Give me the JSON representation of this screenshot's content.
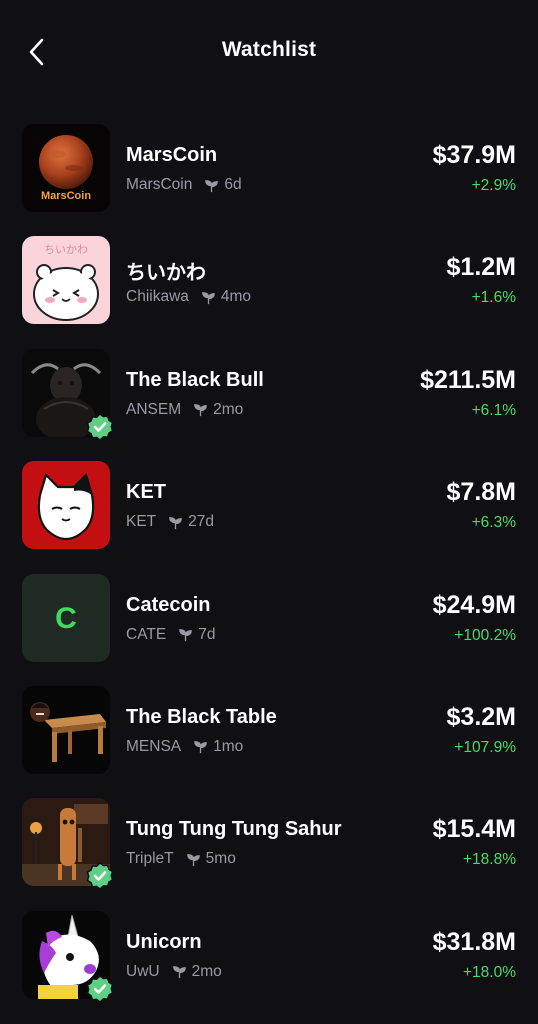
{
  "header": {
    "title": "Watchlist",
    "back_icon": "chevron-left-icon"
  },
  "colors": {
    "background": "#0f0f14",
    "positive": "#4cd964",
    "muted": "#9a9aa4",
    "verified": "#5fcf86"
  },
  "tokens": [
    {
      "name": "MarsCoin",
      "ticker": "MarsCoin",
      "age": "6d",
      "market_cap": "$37.9M",
      "change": "+2.9%",
      "verified": false,
      "thumb_label": "MarsCoin"
    },
    {
      "name": "ちいかわ",
      "ticker": "Chiikawa",
      "age": "4mo",
      "market_cap": "$1.2M",
      "change": "+1.6%",
      "verified": false,
      "thumb_label": "ちいかわ"
    },
    {
      "name": "The Black Bull",
      "ticker": "ANSEM",
      "age": "2mo",
      "market_cap": "$211.5M",
      "change": "+6.1%",
      "verified": true
    },
    {
      "name": "KET",
      "ticker": "KET",
      "age": "27d",
      "market_cap": "$7.8M",
      "change": "+6.3%",
      "verified": false
    },
    {
      "name": "Catecoin",
      "ticker": "CATE",
      "age": "7d",
      "market_cap": "$24.9M",
      "change": "+100.2%",
      "verified": false,
      "thumb_label": "C"
    },
    {
      "name": "The Black Table",
      "ticker": "MENSA",
      "age": "1mo",
      "market_cap": "$3.2M",
      "change": "+107.9%",
      "verified": false
    },
    {
      "name": "Tung Tung Tung Sahur",
      "ticker": "TripleT",
      "age": "5mo",
      "market_cap": "$15.4M",
      "change": "+18.8%",
      "verified": true
    },
    {
      "name": "Unicorn",
      "ticker": "UwU",
      "age": "2mo",
      "market_cap": "$31.8M",
      "change": "+18.0%",
      "verified": true
    }
  ]
}
